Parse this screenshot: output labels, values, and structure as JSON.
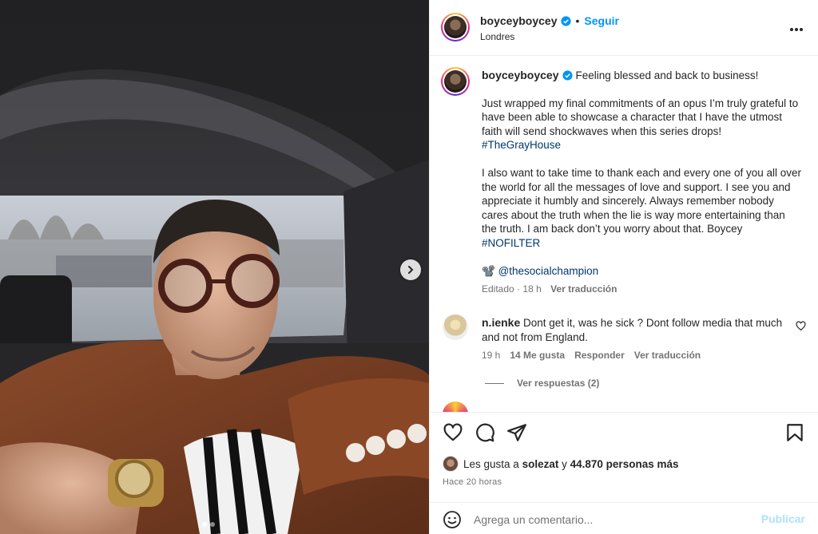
{
  "post": {
    "username": "boyceyboycey",
    "location": "Londres",
    "follow_label": "Seguir",
    "more_label": "•••",
    "separator": "•"
  },
  "caption": {
    "username": "boyceyboycey",
    "line1": "Feeling blessed and back to business!",
    "para1": "Just wrapped my final commitments of an opus I’m truly grateful to have been able to showcase a character that I have the utmost faith will send shockwaves when this series drops!",
    "hashtag1": "#TheGrayHouse",
    "para2": "I also want to take time to thank each and every one of you all over the world for all the messages of love and support. I see you and appreciate it humbly and sincerely. Always remember nobody cares about the truth when the lie is way more entertaining than the truth. I am back don’t you worry about that. Boycey",
    "hashtag2": "#NOFILTER",
    "credit_emoji": "📽️",
    "mention": "@thesocialchampion",
    "edited": "Editado",
    "dot": "·",
    "edited_time": "18 h",
    "translate": "Ver traducción"
  },
  "comment": {
    "username": "n.ienke",
    "text": "Dont get it, was he sick ? Dont follow media that much and not from England.",
    "time": "19 h",
    "likes": "14 Me gusta",
    "reply": "Responder",
    "translate": "Ver traducción",
    "view_replies": "Ver respuestas (2)"
  },
  "likes": {
    "prefix": "Les gusta a",
    "user": "solezat",
    "conj": "y",
    "count": "44.870 personas más"
  },
  "time_ago": "Hace 20 horas",
  "add_comment": {
    "placeholder": "Agrega un comentario...",
    "publish": "Publicar"
  },
  "carousel": {
    "slides": 2,
    "current": 1
  },
  "colors": {
    "link": "#0095f6",
    "hashtag": "#00376b",
    "muted": "#737373",
    "verified": "#0095f6"
  },
  "icons": [
    "chevron-right-icon",
    "verified-icon",
    "more-icon",
    "heart-icon",
    "comment-icon",
    "share-icon",
    "bookmark-icon",
    "emoji-icon"
  ]
}
